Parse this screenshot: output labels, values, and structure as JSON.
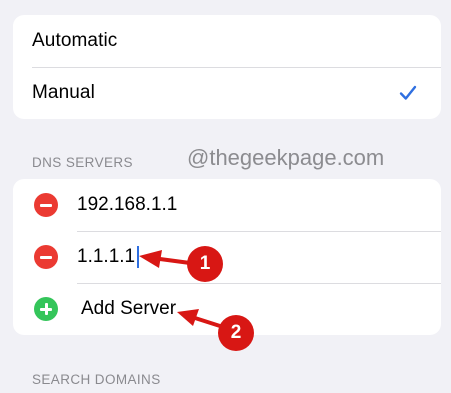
{
  "mode_options": {
    "automatic_label": "Automatic",
    "manual_label": "Manual",
    "selected": "Manual"
  },
  "dns_section": {
    "title": "DNS SERVERS",
    "servers": [
      "192.168.1.1",
      "1.1.1.1"
    ],
    "add_label": "Add Server"
  },
  "search_section": {
    "title": "SEARCH DOMAINS"
  },
  "watermark": "@thegeekpage.com",
  "annotations": {
    "step1": "1",
    "step2": "2"
  },
  "icons": [
    "checkmark-icon",
    "remove-server-icon",
    "add-server-icon",
    "red-arrow-icon"
  ],
  "colors": {
    "background": "#f1f1f6",
    "check_blue": "#2f6fe0",
    "minus_red": "#eb3a32",
    "plus_green": "#34c55a",
    "annotation_red": "#d81714"
  }
}
